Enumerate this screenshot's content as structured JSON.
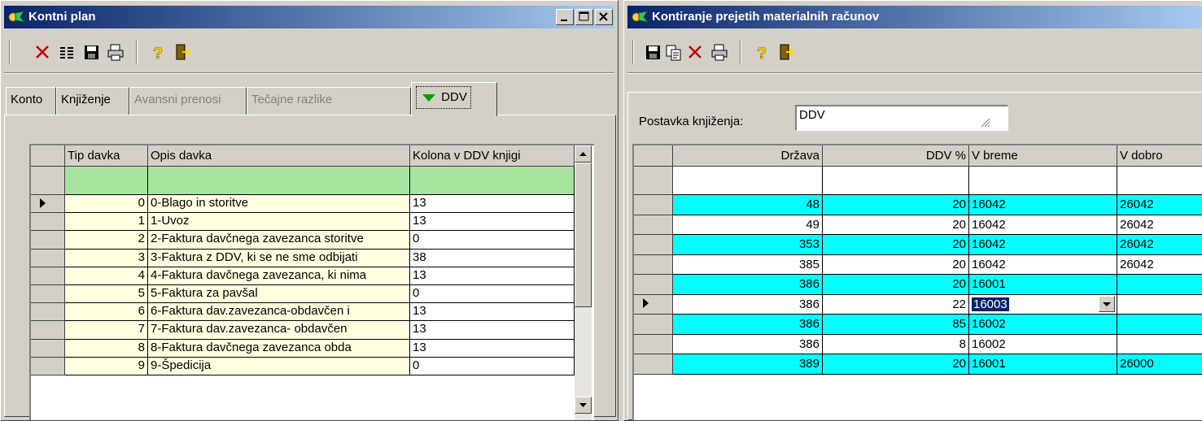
{
  "left_window": {
    "title": "Kontni plan",
    "tabs": [
      {
        "label": "Konto",
        "enabled": true
      },
      {
        "label": "Knjiženje",
        "enabled": true
      },
      {
        "label": "Avansni prenosi",
        "enabled": false
      },
      {
        "label": "Tečajne razlike",
        "enabled": false
      },
      {
        "label": "DDV",
        "enabled": true,
        "active": true
      }
    ],
    "grid": {
      "headers": [
        "Tip davka",
        "Opis davka",
        "Kolona v DDV knjigi"
      ],
      "rows": [
        [
          "0",
          "0-Blago in storitve",
          "13"
        ],
        [
          "1",
          "1-Uvoz",
          "13"
        ],
        [
          "2",
          "2-Faktura davčnega zavezanca storitve",
          "0"
        ],
        [
          "3",
          "3-Faktura z DDV, ki se ne sme odbijati",
          "38"
        ],
        [
          "4",
          "4-Faktura davčnega zavezanca, ki nima",
          "13"
        ],
        [
          "5",
          "5-Faktura za pavšal",
          "0"
        ],
        [
          "6",
          "6-Faktura dav.zavezanca-obdavčen i",
          "13"
        ],
        [
          "7",
          "7-Faktura dav.zavezanca- obdavčen",
          "13"
        ],
        [
          "8",
          "8-Faktura davčnega zavezanca obda",
          "13"
        ],
        [
          "9",
          "9-Špedicija",
          "0"
        ]
      ],
      "current_row": 0
    }
  },
  "right_window": {
    "title": "Kontiranje prejetih materialnih računov",
    "posting_label": "Postavka knjiženja:",
    "posting_value": "DDV",
    "grid": {
      "headers": [
        "Država",
        "DDV %",
        "V breme",
        "V dobro"
      ],
      "rows": [
        [
          "48",
          "20",
          "16042",
          "26042"
        ],
        [
          "49",
          "20",
          "16042",
          "26042"
        ],
        [
          "353",
          "20",
          "16042",
          "26042"
        ],
        [
          "385",
          "20",
          "16042",
          "26042"
        ],
        [
          "386",
          "20",
          "16001",
          ""
        ],
        [
          "386",
          "22",
          "16003",
          ""
        ],
        [
          "386",
          "85",
          "16002",
          ""
        ],
        [
          "386",
          "8",
          "16002",
          ""
        ],
        [
          "389",
          "20",
          "16001",
          "26000"
        ]
      ],
      "current_row": 5
    }
  },
  "colors": {
    "highlight_row": "#00ffff",
    "new_row": "#a8e4a0",
    "number_cell": "#ffffe0",
    "selection": "#0a246a",
    "title_gradient_start": "#0a246a",
    "title_gradient_end": "#a6caf0"
  },
  "icons": {
    "toolbar_left": [
      "delete-icon",
      "columns-icon",
      "save-icon",
      "print-icon",
      "help-icon",
      "exit-icon"
    ],
    "toolbar_right": [
      "save-icon",
      "copy-icon",
      "delete-icon",
      "print-icon",
      "help-icon",
      "exit-icon"
    ]
  }
}
